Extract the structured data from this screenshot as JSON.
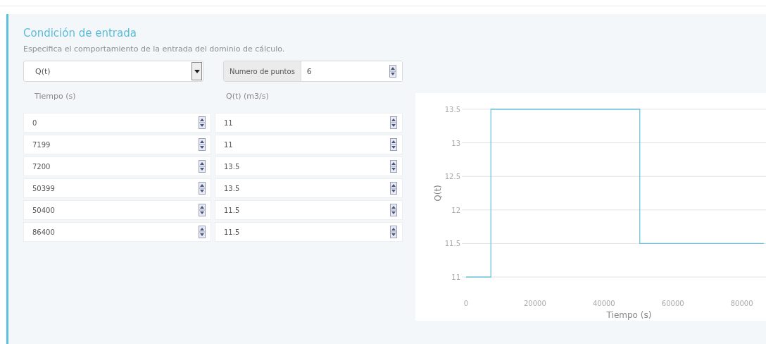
{
  "section": {
    "title": "Condición de entrada",
    "description": "Especifica el comportamiento de la entrada del dominio de cálculo."
  },
  "condition_select": {
    "value": "Q(t)"
  },
  "points": {
    "label": "Numero de puntos",
    "value": "6"
  },
  "table": {
    "columns": [
      "Tiempo (s)",
      "Q(t) (m3/s)"
    ],
    "rows": [
      [
        "0",
        "11"
      ],
      [
        "7199",
        "11"
      ],
      [
        "7200",
        "13.5"
      ],
      [
        "50399",
        "13.5"
      ],
      [
        "50400",
        "11.5"
      ],
      [
        "86400",
        "11.5"
      ]
    ]
  },
  "chart": {
    "chart_data": {
      "type": "line",
      "xlabel": "Tiempo (s)",
      "ylabel": "Q(t)",
      "x": [
        0,
        7199,
        7200,
        50399,
        50400,
        86400
      ],
      "grid": true,
      "series": [
        {
          "color": "#6cc5dc",
          "values": [
            11,
            11,
            13.5,
            13.5,
            11.5,
            11.5
          ]
        }
      ],
      "xlim": [
        0,
        86400
      ],
      "ylim": [
        11,
        13.5
      ],
      "xticks": [
        0,
        20000,
        40000,
        60000,
        80000
      ],
      "yticks": [
        11,
        11.5,
        12,
        12.5,
        13,
        13.5
      ]
    }
  }
}
